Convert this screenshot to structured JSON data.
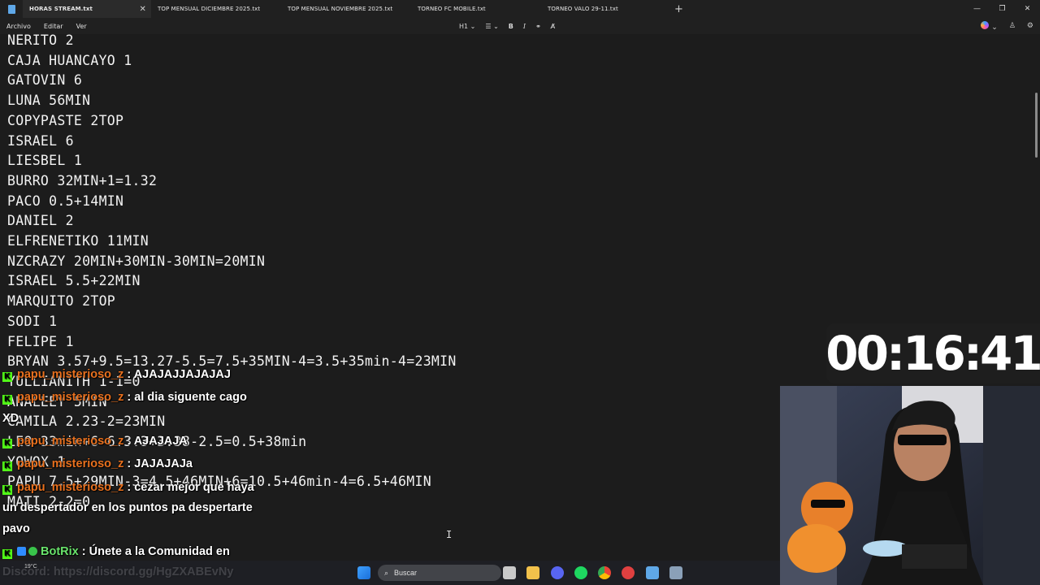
{
  "tabs": [
    {
      "label": "HORAS STREAM.txt",
      "active": true
    },
    {
      "label": "TOP MENSUAL DICIEMBRE 2025.txt"
    },
    {
      "label": "TOP MENSUAL NOVIEMBRE 2025.txt"
    },
    {
      "label": "TORNEO FC MOBILE.txt"
    },
    {
      "label": "TORNEO VALO 29-11.txt"
    }
  ],
  "menu": {
    "file": "Archivo",
    "edit": "Editar",
    "view": "Ver"
  },
  "format": {
    "heading": "H1"
  },
  "lines": [
    "NERITO 2",
    "CAJA HUANCAYO 1",
    "GATOVIN 6",
    "LUNA 56MIN",
    "COPYPASTE 2TOP",
    "ISRAEL 6",
    "LIESBEL 1",
    "BURRO 32MIN+1=1.32",
    "PACO 0.5+14MIN",
    "DANIEL 2",
    "ELFRENETIKO 11MIN",
    "NZCRAZY 20MIN+30MIN-30MIN=20MIN",
    "ISRAEL 5.5+22MIN",
    "MARQUITO 2TOP",
    "SODI 1",
    "FELIPE 1",
    "BRYAN 3.57+9.5=13.27-5.5=7.5+35MIN-4=3.5+35min-4=23MIN",
    "YULLIANITH 1-1=0",
    "ANALEEY 5MIN",
    "CAMILA 2.23-2=23MIN",
    "LEO 33min+6-6.3.3+3.38-2.5=0.5+38min",
    "YOWOX 1",
    "PAPU 7.5+29MIN-3=4.5+46MIN+6=10.5+46min-4=6.5+46MIN",
    "MATI 2-2=0"
  ],
  "timer": "00:16:41",
  "chat": [
    {
      "user": "papu_misterioso_z",
      "message": ": AJAJAJJAJAJAJ"
    },
    {
      "user": "papu_misterioso_z",
      "message": ": al dia siguente cago"
    },
    {
      "message_cont": "XD"
    },
    {
      "user": "papu_misterioso_z",
      "message": ": AJAJAJA"
    },
    {
      "user": "papu_misterioso_z",
      "message": ": JAJAJAJa"
    },
    {
      "user": "papu_misterioso_z",
      "message": ": cezar mejor que haya"
    },
    {
      "message_cont": "un despertador en los puntos pa despertarte"
    },
    {
      "message_cont": "pavo"
    },
    {
      "user": "BotRix",
      "message": ": Únete a la Comunidad en"
    },
    {
      "message_cont": "Discord: https://discord.gg/HgZXABEvNy"
    }
  ],
  "taskbar": {
    "search_placeholder": "Buscar",
    "weather": "19°C"
  },
  "colors": {
    "editor_bg": "#1c1c1c",
    "chat_user": "#e8701e",
    "bot_user": "#69e36b",
    "kick_badge": "#53fc18"
  }
}
